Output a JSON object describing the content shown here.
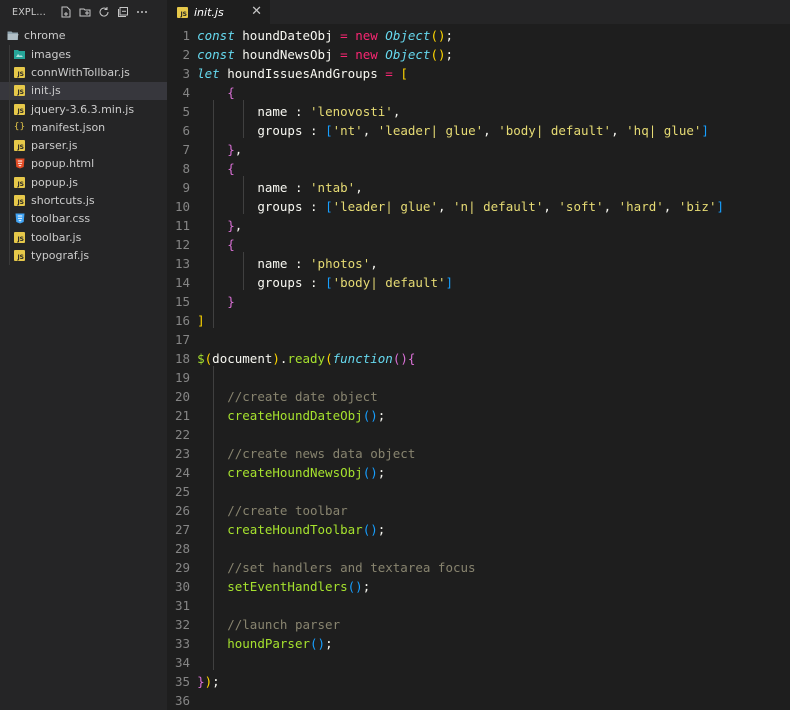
{
  "explorer": {
    "title": "EXPL...",
    "header_icons": [
      "new-file-icon",
      "new-folder-icon",
      "refresh-icon",
      "collapse-all-icon",
      "more-icon"
    ],
    "folder": "chrome",
    "files": [
      {
        "name": "images",
        "icon": "image-folder-icon"
      },
      {
        "name": "connWithTollbar.js",
        "icon": "js-file-icon"
      },
      {
        "name": "init.js",
        "icon": "js-file-icon",
        "active": true
      },
      {
        "name": "jquery-3.6.3.min.js",
        "icon": "js-file-icon"
      },
      {
        "name": "manifest.json",
        "icon": "json-file-icon"
      },
      {
        "name": "parser.js",
        "icon": "js-file-icon"
      },
      {
        "name": "popup.html",
        "icon": "html-file-icon"
      },
      {
        "name": "popup.js",
        "icon": "js-file-icon"
      },
      {
        "name": "shortcuts.js",
        "icon": "js-file-icon"
      },
      {
        "name": "toolbar.css",
        "icon": "css-file-icon"
      },
      {
        "name": "toolbar.js",
        "icon": "js-file-icon"
      },
      {
        "name": "typograf.js",
        "icon": "js-file-icon"
      }
    ]
  },
  "tab": {
    "label": "init.js",
    "close": "✕"
  },
  "editor": {
    "lines": [
      "const houndDateObj = new Object();",
      "const houndNewsObj = new Object();",
      "let houndIssuesAndGroups = [",
      "    {",
      "        name : 'lenovosti',",
      "        groups : ['nt', 'leader| glue', 'body| default', 'hq| glue']",
      "    },",
      "    {",
      "        name : 'ntab',",
      "        groups : ['leader| glue', 'n| default', 'soft', 'hard', 'biz']",
      "    },",
      "    {",
      "        name : 'photos',",
      "        groups : ['body| default']",
      "    }",
      "]",
      "",
      "$(document).ready(function(){",
      "",
      "    //create date object",
      "    createHoundDateObj();",
      "",
      "    //create news data object",
      "    createHoundNewsObj();",
      "",
      "    //create toolbar",
      "    createHoundToolbar();",
      "",
      "    //set handlers and textarea focus",
      "    setEventHandlers();",
      "",
      "    //launch parser",
      "    houndParser();",
      "",
      "});",
      ""
    ]
  }
}
